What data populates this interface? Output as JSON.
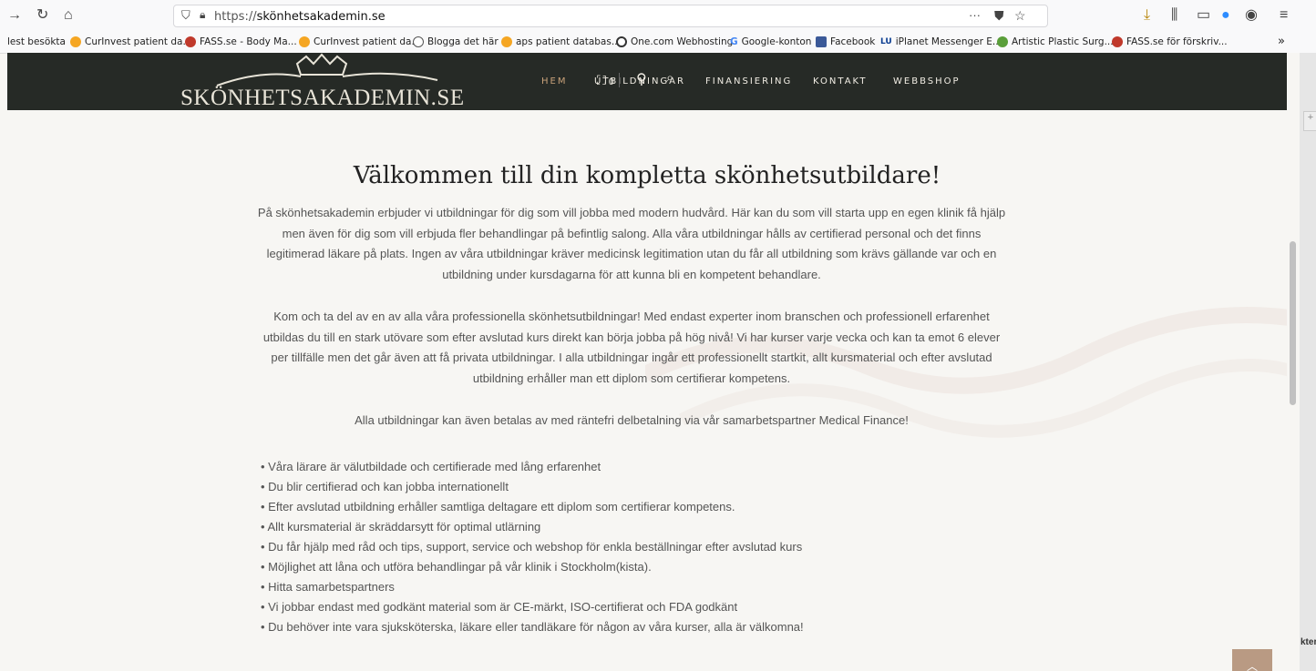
{
  "browser": {
    "url_prefix": "https://",
    "url_domain": "skönhetsakademin.se",
    "more_label": "···",
    "bookmarks": [
      {
        "label": "lest besökta",
        "color": ""
      },
      {
        "label": "CurInvest patient da...",
        "color": "#f5a623"
      },
      {
        "label": "FASS.se - Body Ma...",
        "color": "#c0392b"
      },
      {
        "label": "CurInvest patient da...",
        "color": "#f5a623"
      },
      {
        "label": "Blogga det här",
        "color": "#555555"
      },
      {
        "label": "aps patient databas...",
        "color": "#f5a623"
      },
      {
        "label": "One.com Webhosting",
        "color": "#333333"
      },
      {
        "label": "Google-konton",
        "color": "#4285f4"
      },
      {
        "label": "Facebook",
        "color": "#3b5998"
      },
      {
        "label": "iPlanet Messenger E...",
        "color": "#0b3d91"
      },
      {
        "label": "Artistic Plastic Surg...",
        "color": "#5a9e3a"
      },
      {
        "label": "FASS.se för förskriv...",
        "color": "#c0392b"
      }
    ],
    "bookmark_overflow": "»"
  },
  "site": {
    "logo": "SKÖNHETSAKADEMIN.SE",
    "nav": [
      "HEM",
      "UTBILDNINGAR",
      "FINANSIERING",
      "KONTAKT",
      "WEBBSHOP"
    ],
    "cart_count": "0"
  },
  "content": {
    "title": "Välkommen till din kompletta skönhetsutbildare!",
    "p1": "På skönhetsakademin erbjuder vi utbildningar för dig som vill jobba med modern hudvård. Här kan du som vill starta upp en egen klinik få hjälp men även för dig som vill erbjuda fler behandlingar på befintlig salong. Alla våra utbildningar hålls av certifierad personal och det finns legitimerad läkare på plats. Ingen av våra utbildningar kräver medicinsk legitimation utan du får all utbildning som krävs gällande var och en utbildning under kursdagarna för att kunna bli en kompetent behandlare.",
    "p2": "Kom och ta del av en av alla våra professionella skönhetsutbildningar! Med endast experter inom branschen och professionell erfarenhet utbildas du till en stark utövare som efter avslutad kurs direkt kan börja jobba på hög nivå! Vi har kurser varje vecka och kan ta emot 6 elever per tillfälle men det går även att få privata utbildningar. I alla utbildningar ingår ett professionellt startkit, allt kursmaterial och efter avslutad utbildning erhåller man ett diplom som certifierar kompetens.",
    "p3": "Alla utbildningar kan även betalas av med räntefri delbetalning via vår samarbetspartner Medical Finance!",
    "bullets": [
      "Våra lärare är välutbildade och certifierade med lång erfarenhet",
      "Du blir certifierad och kan jobba internationellt",
      "Efter avslutad utbildning erhåller samtliga deltagare ett diplom som certifierar kompetens.",
      "Allt kursmaterial är skräddarsytt för optimal utlärning",
      "Du får hjälp med råd och tips, support, service och webshop för enkla beställningar efter avslutad kurs",
      "Möjlighet att låna och utföra behandlingar på vår klinik i Stockholm(kista).",
      "Hitta samarbetspartners",
      "Vi jobbar endast med godkänt material som är CE-märkt, ISO-certifierat och FDA godkänt",
      "Du behöver inte vara sjuksköterska, läkare eller tandläkare för någon av våra kurser, alla är välkomna!"
    ]
  },
  "side_panel_text": "kter"
}
